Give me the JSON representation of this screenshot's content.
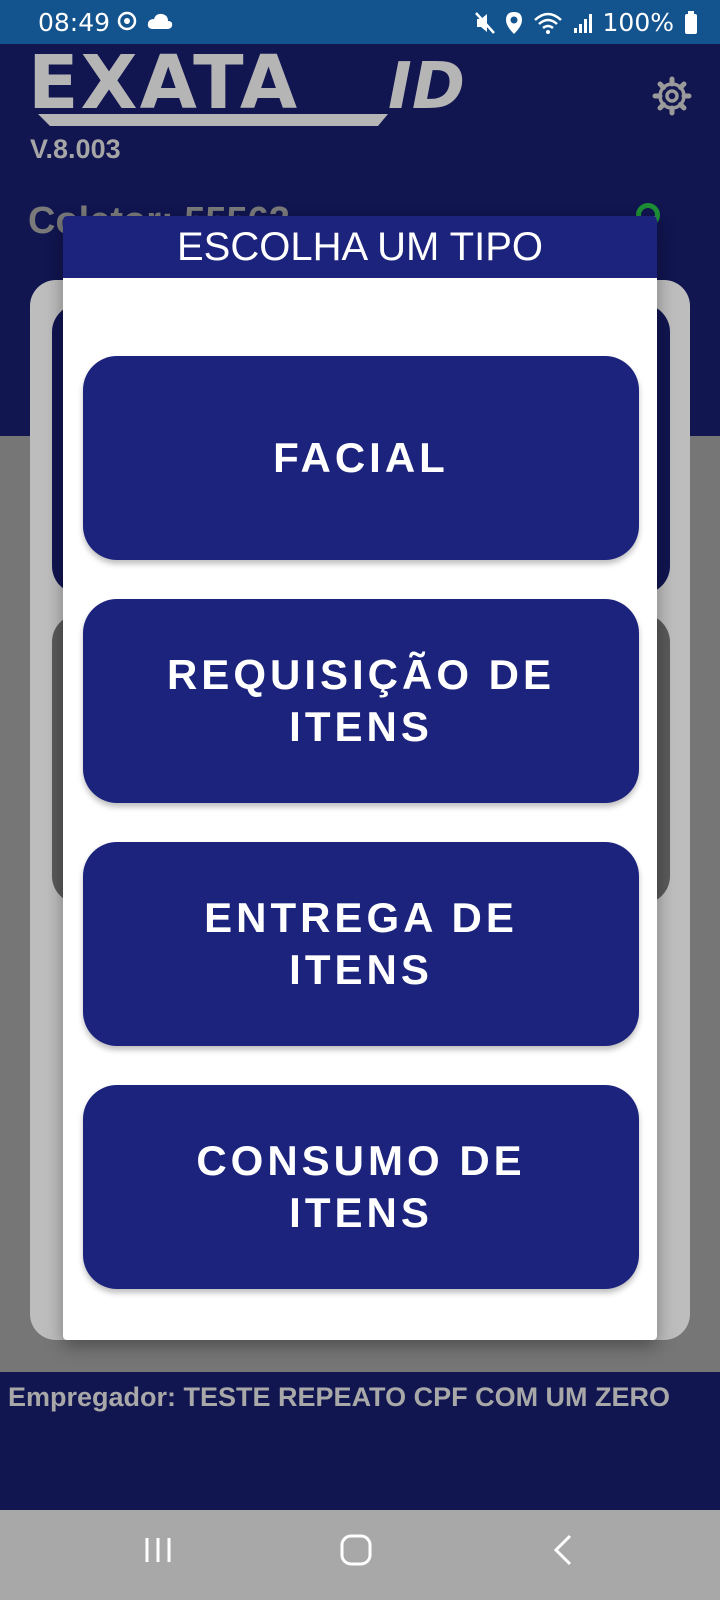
{
  "status_bar": {
    "time": "08:49",
    "battery": "100%",
    "icons": [
      "sync-icon",
      "cloud-icon",
      "mute-icon",
      "location-icon",
      "wifi-icon",
      "signal-icon",
      "battery-icon"
    ]
  },
  "header": {
    "logo_text": "EXATA",
    "logo_suffix": "ID",
    "version": "V.8.003",
    "collector_text": "Coletor: 55562"
  },
  "dialog": {
    "title": "ESCOLHA UM TIPO",
    "options": [
      {
        "label": "FACIAL"
      },
      {
        "label": "REQUISIÇÃO DE ITENS"
      },
      {
        "label": "ENTREGA DE ITENS"
      },
      {
        "label": "CONSUMO DE ITENS"
      }
    ]
  },
  "footer": {
    "employer": "Empregador: TESTE REPEATO CPF COM UM ZERO"
  },
  "nav": {
    "icons": [
      "recent-apps-icon",
      "home-icon",
      "back-icon"
    ]
  },
  "colors": {
    "primary": "#1c237d",
    "status_bar": "#13548f",
    "accent_green": "#1d8f35"
  }
}
